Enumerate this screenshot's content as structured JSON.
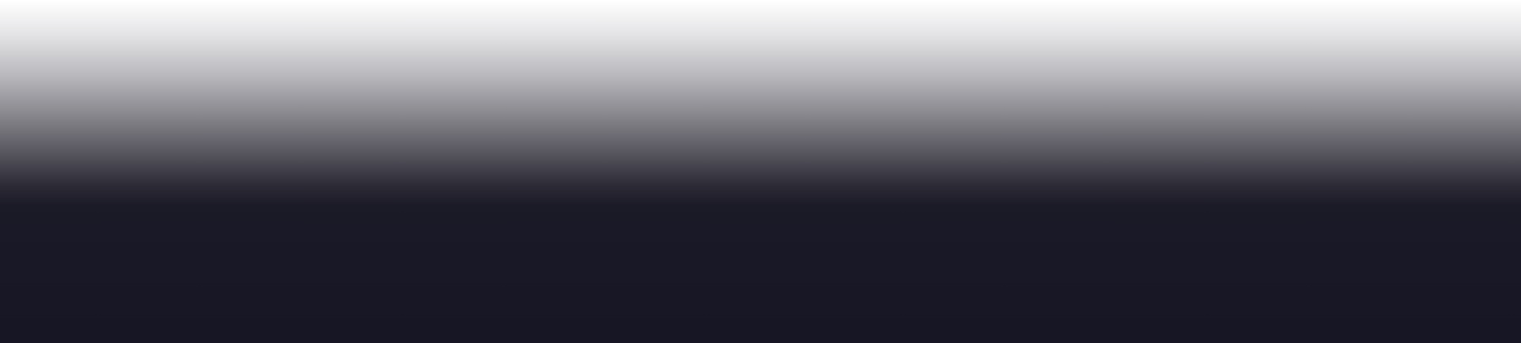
{
  "colors": {
    "top": "#ffffff",
    "mid": "#8a898f",
    "bottom": "#161624"
  }
}
